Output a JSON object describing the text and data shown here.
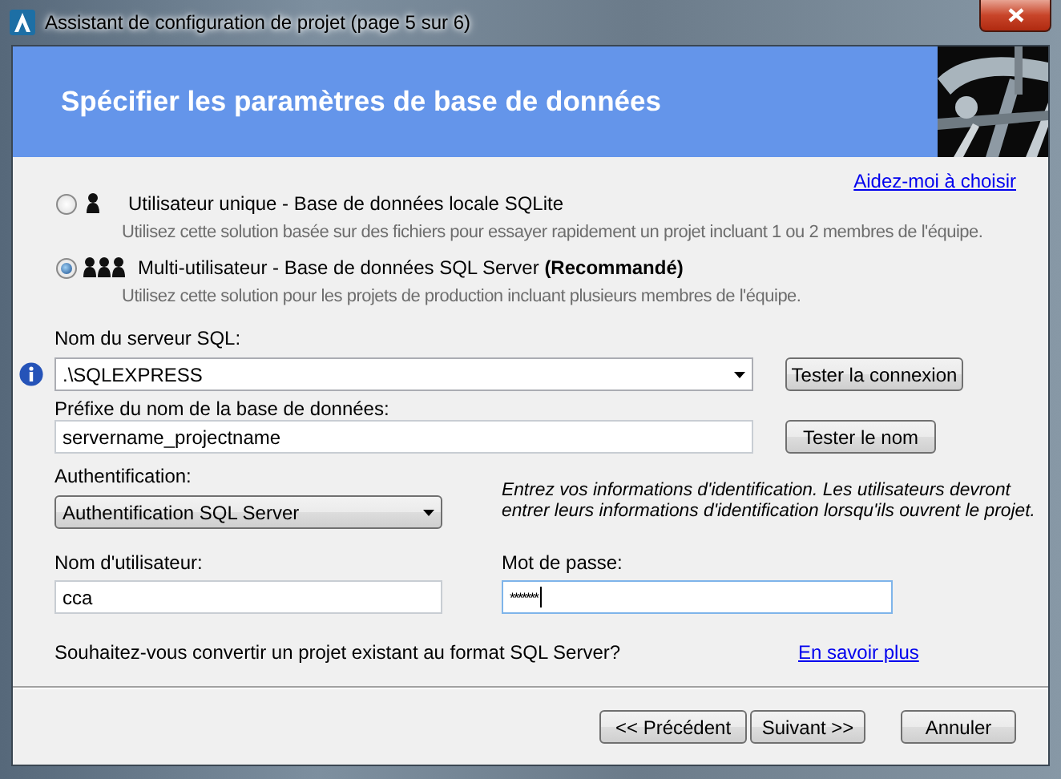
{
  "window": {
    "title": "Assistant de configuration de projet (page 5 sur 6)"
  },
  "header": {
    "title": "Spécifier les paramètres de base de données"
  },
  "help_link": "Aidez-moi à choisir",
  "options": [
    {
      "kind": "single",
      "label": "Utilisateur unique - Base de données locale SQLite",
      "description": "Utilisez cette solution basée sur des fichiers pour essayer rapidement un projet incluant 1 ou 2 membres de l'équipe.",
      "selected": false
    },
    {
      "kind": "multi",
      "label": "Multi-utilisateur - Base de données SQL Server **(Recommandé)**",
      "description": "Utilisez cette solution pour les projets de production incluant plusieurs membres de l'équipe.",
      "selected": true
    }
  ],
  "server": {
    "label": "Nom du serveur SQL:",
    "value": ".\\SQLEXPRESS",
    "button": "Tester la connexion"
  },
  "prefix": {
    "label": "Préfixe du nom de la base de données:",
    "value": "servername_projectname",
    "button": "Tester le nom"
  },
  "authentication": {
    "label": "Authentification:",
    "value": "Authentification SQL Server",
    "note": "Entrez vos informations d'identification. Les utilisateurs devront entrer leurs informations d'identification lorsqu'ils ouvrent le projet."
  },
  "username": {
    "label": "Nom d'utilisateur:",
    "value": "cca"
  },
  "password": {
    "label": "Mot de passe:",
    "value": "*******"
  },
  "convert": {
    "question": "Souhaitez-vous convertir un projet existant au format SQL Server?",
    "link": "En savoir plus"
  },
  "buttons": [
    "<< Précédent",
    "Suivant >>",
    "Annuler"
  ]
}
